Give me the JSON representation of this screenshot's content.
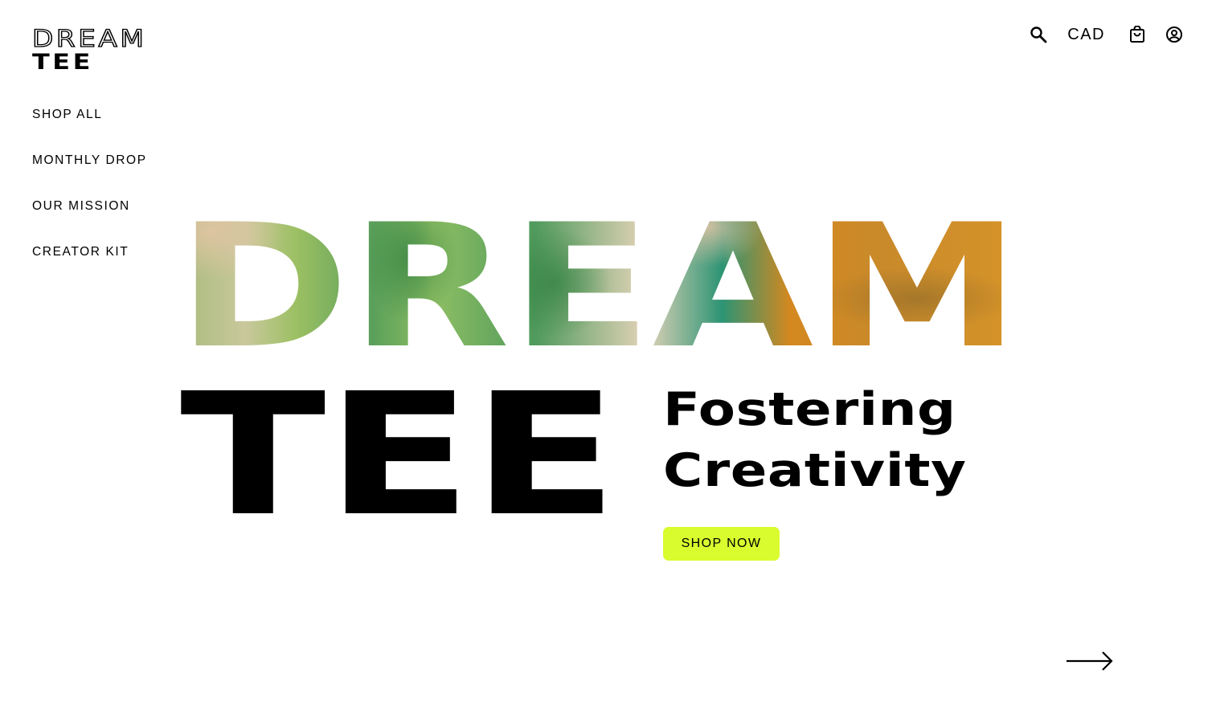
{
  "brand": {
    "logo_line1": "DREAM",
    "logo_line2": "TEE"
  },
  "nav": {
    "items": [
      {
        "label": "SHOP ALL"
      },
      {
        "label": "MONTHLY DROP"
      },
      {
        "label": "OUR MISSION"
      },
      {
        "label": "CREATOR KIT"
      }
    ]
  },
  "header": {
    "currency": "CAD",
    "icons": [
      "search-icon",
      "shopping-bag-icon",
      "account-icon"
    ]
  },
  "hero": {
    "word1": "DREAM",
    "word2": "TEE",
    "tagline_line1": "Fostering",
    "tagline_line2": "Creativity",
    "cta_label": "SHOP NOW",
    "next_icon": "arrow-right-icon"
  },
  "colors": {
    "accent": "#d8fc2e",
    "text": "#000000",
    "texture_green_light": "#9dbf63",
    "texture_green_dark": "#2f8a4d",
    "texture_beige": "#e2cfb4",
    "texture_orange": "#d4881f"
  }
}
